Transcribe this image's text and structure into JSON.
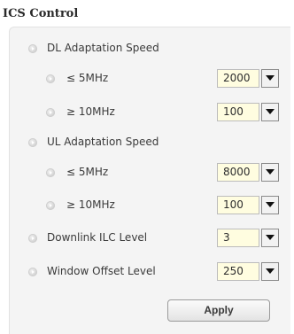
{
  "section": {
    "title": "ICS Control"
  },
  "dl": {
    "label": "DL Adaptation Speed",
    "le5": {
      "label": "≤ 5MHz",
      "value": "2000"
    },
    "ge10": {
      "label": "≥ 10MHz",
      "value": "100"
    }
  },
  "ul": {
    "label": "UL Adaptation Speed",
    "le5": {
      "label": "≤ 5MHz",
      "value": "8000"
    },
    "ge10": {
      "label": "≥ 10MHz",
      "value": "100"
    }
  },
  "downlink_ilc": {
    "label": "Downlink ILC Level",
    "value": "3"
  },
  "window_offset": {
    "label": "Window Offset Level",
    "value": "250"
  },
  "actions": {
    "apply_label": "Apply"
  },
  "colors": {
    "panel_bg": "#f4f4f4",
    "select_bg": "#fffde0"
  },
  "icons": {
    "bullet": "bullet-arrow-icon",
    "dropdown": "chevron-down-icon"
  }
}
